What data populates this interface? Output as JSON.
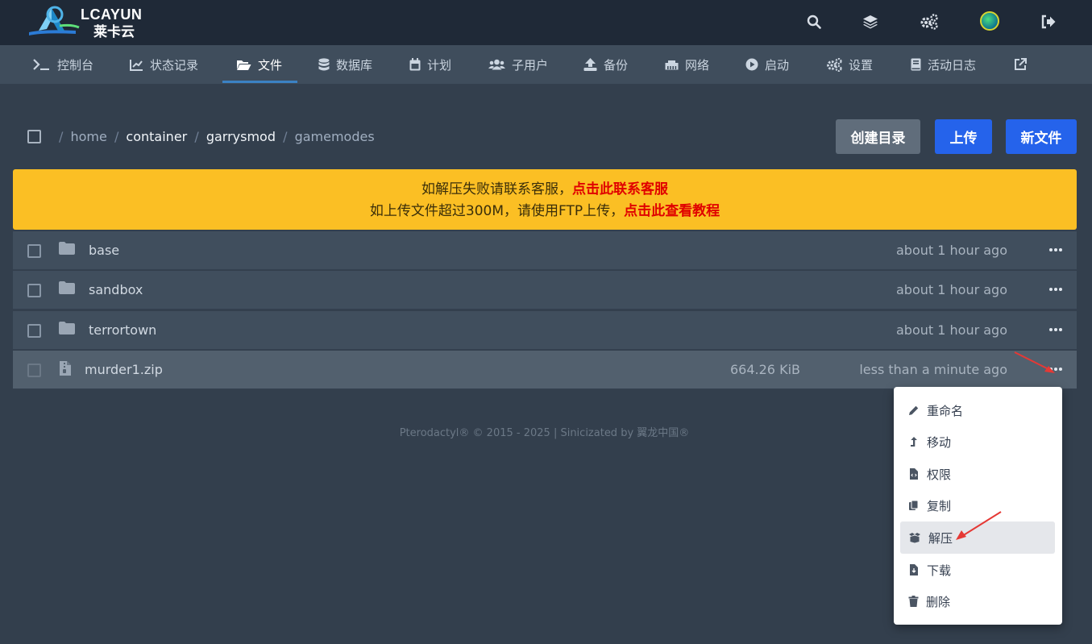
{
  "brand": {
    "name": "LCAYUN",
    "name_cn": "莱卡云"
  },
  "topbar": {
    "icons": [
      "search-icon",
      "layers-icon",
      "cogs-icon",
      "avatar",
      "sign-out-icon"
    ]
  },
  "nav": {
    "items": [
      {
        "label": "控制台",
        "icon": "terminal-icon"
      },
      {
        "label": "状态记录",
        "icon": "chart-line-icon"
      },
      {
        "label": "文件",
        "icon": "folder-open-icon"
      },
      {
        "label": "数据库",
        "icon": "database-icon"
      },
      {
        "label": "计划",
        "icon": "calendar-icon"
      },
      {
        "label": "子用户",
        "icon": "users-icon"
      },
      {
        "label": "备份",
        "icon": "upload-icon"
      },
      {
        "label": "网络",
        "icon": "ethernet-icon"
      },
      {
        "label": "启动",
        "icon": "play-circle-icon"
      },
      {
        "label": "设置",
        "icon": "cogs-icon"
      },
      {
        "label": "活动日志",
        "icon": "book-icon"
      }
    ],
    "active": "文件",
    "external_icon": "external-link-icon"
  },
  "breadcrumb": {
    "parts": [
      "home",
      "container",
      "garrysmod",
      "gamemodes"
    ],
    "separator": "/"
  },
  "actions": {
    "create_dir": "创建目录",
    "upload": "上传",
    "new_file": "新文件"
  },
  "notice": {
    "line1_text": "如解压失败请联系客服，",
    "line1_link": "点击此联系客服",
    "line2_text": "如上传文件超过300M，请使用FTP上传，",
    "line2_link": "点击此查看教程",
    "bg_color": "#fbbf24",
    "link_color": "#e00000"
  },
  "files": [
    {
      "name": "base",
      "type": "folder",
      "size": "",
      "modified": "about 1 hour ago"
    },
    {
      "name": "sandbox",
      "type": "folder",
      "size": "",
      "modified": "about 1 hour ago"
    },
    {
      "name": "terrortown",
      "type": "folder",
      "size": "",
      "modified": "about 1 hour ago"
    },
    {
      "name": "murder1.zip",
      "type": "archive",
      "size": "664.26 KiB",
      "modified": "less than a minute ago"
    }
  ],
  "context_menu": {
    "items": [
      {
        "label": "重命名",
        "icon": "pencil-icon"
      },
      {
        "label": "移动",
        "icon": "level-up-icon"
      },
      {
        "label": "权限",
        "icon": "file-code-icon"
      },
      {
        "label": "复制",
        "icon": "copy-icon"
      },
      {
        "label": "解压",
        "icon": "box-open-icon"
      },
      {
        "label": "下载",
        "icon": "file-download-icon"
      },
      {
        "label": "删除",
        "icon": "trash-icon"
      }
    ],
    "highlighted": "解压"
  },
  "footer": {
    "text": "Pterodactyl® © 2015 - 2025 | Sinicizated by 翼龙中国®"
  },
  "colors": {
    "accent_blue": "#2563eb",
    "annotation_red": "#e53935"
  }
}
